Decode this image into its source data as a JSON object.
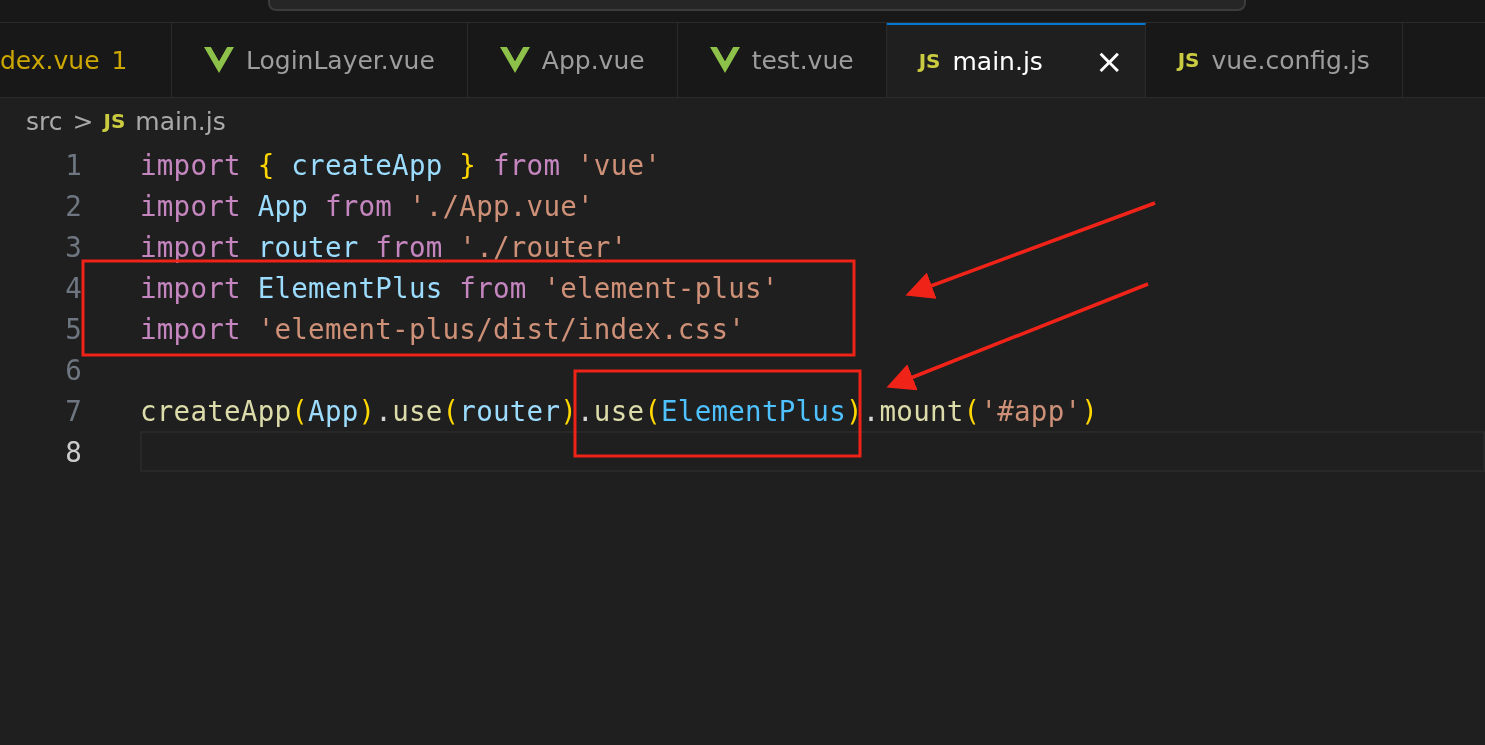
{
  "tabs": [
    {
      "label": "dex.vue",
      "kind": "plain",
      "problems": "1",
      "selected": false
    },
    {
      "label": "LoginLayer.vue",
      "kind": "vue",
      "selected": false
    },
    {
      "label": "App.vue",
      "kind": "vue",
      "selected": false
    },
    {
      "label": "test.vue",
      "kind": "vue",
      "selected": false
    },
    {
      "label": "main.js",
      "kind": "js",
      "icon_text": "JS",
      "selected": true,
      "close": "×"
    },
    {
      "label": "vue.config.js",
      "kind": "js",
      "icon_text": "JS",
      "selected": false
    }
  ],
  "breadcrumb": {
    "folder": "src",
    "separator": ">",
    "icon_text": "JS",
    "file": "main.js"
  },
  "editor": {
    "lines": [
      {
        "number": "1",
        "current": false,
        "tokens": [
          {
            "t": "import ",
            "kind": "keyword"
          },
          {
            "t": "{ ",
            "kind": "brace"
          },
          {
            "t": "createApp ",
            "kind": "variable"
          },
          {
            "t": "} ",
            "kind": "brace"
          },
          {
            "t": "from ",
            "kind": "keyword"
          },
          {
            "t": "'vue'",
            "kind": "string"
          }
        ]
      },
      {
        "number": "2",
        "current": false,
        "tokens": [
          {
            "t": "import ",
            "kind": "keyword"
          },
          {
            "t": "App ",
            "kind": "variable"
          },
          {
            "t": "from ",
            "kind": "keyword"
          },
          {
            "t": "'./App.vue'",
            "kind": "string"
          }
        ]
      },
      {
        "number": "3",
        "current": false,
        "tokens": [
          {
            "t": "import ",
            "kind": "keyword"
          },
          {
            "t": "router ",
            "kind": "variable"
          },
          {
            "t": "from ",
            "kind": "keyword"
          },
          {
            "t": "'./router'",
            "kind": "string"
          }
        ]
      },
      {
        "number": "4",
        "current": false,
        "tokens": [
          {
            "t": "import ",
            "kind": "keyword"
          },
          {
            "t": "ElementPlus ",
            "kind": "variable"
          },
          {
            "t": "from ",
            "kind": "keyword"
          },
          {
            "t": "'element-plus'",
            "kind": "string"
          }
        ]
      },
      {
        "number": "5",
        "current": false,
        "tokens": [
          {
            "t": "import ",
            "kind": "keyword"
          },
          {
            "t": "'element-plus/dist/index.css'",
            "kind": "string"
          }
        ]
      },
      {
        "number": "6",
        "current": false
      },
      {
        "number": "7",
        "current": false,
        "tokens": [
          {
            "t": "createApp",
            "kind": "function"
          },
          {
            "t": "(",
            "kind": "brace"
          },
          {
            "t": "App",
            "kind": "variable"
          },
          {
            "t": ")",
            "kind": "brace"
          },
          {
            "t": ".",
            "kind": "plain"
          },
          {
            "t": "use",
            "kind": "function"
          },
          {
            "t": "(",
            "kind": "brace"
          },
          {
            "t": "router",
            "kind": "variable"
          },
          {
            "t": ")",
            "kind": "brace"
          },
          {
            "t": ".",
            "kind": "plain"
          },
          {
            "t": "use",
            "kind": "function"
          },
          {
            "t": "(",
            "kind": "brace"
          },
          {
            "t": "ElementPlus",
            "kind": "constant"
          },
          {
            "t": ")",
            "kind": "brace"
          },
          {
            "t": ".",
            "kind": "plain"
          },
          {
            "t": "mount",
            "kind": "function"
          },
          {
            "t": "(",
            "kind": "brace"
          },
          {
            "t": "'#app'",
            "kind": "string"
          },
          {
            "t": ")",
            "kind": "brace"
          }
        ]
      },
      {
        "number": "8",
        "current": true
      }
    ]
  }
}
